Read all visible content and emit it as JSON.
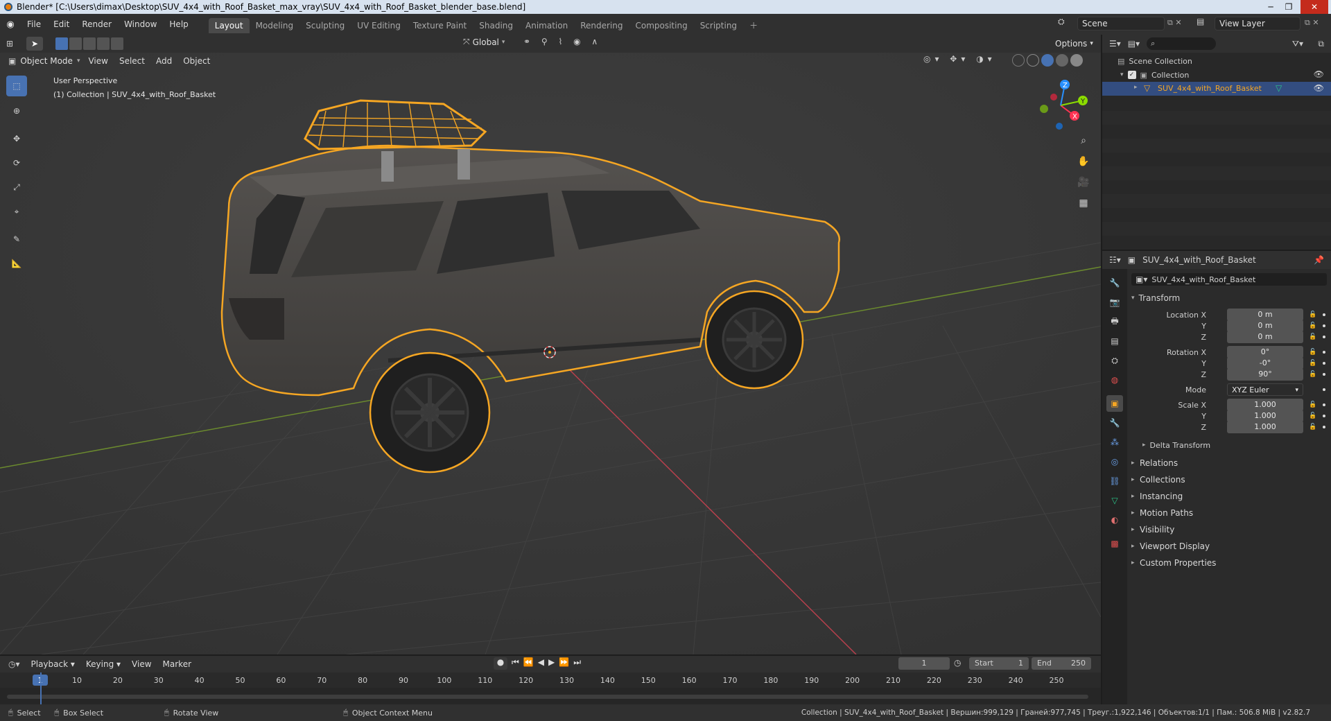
{
  "titlebar": {
    "title": "Blender* [C:\\Users\\dimax\\Desktop\\SUV_4x4_with_Roof_Basket_max_vray\\SUV_4x4_with_Roof_Basket_blender_base.blend]"
  },
  "menu": [
    "File",
    "Edit",
    "Render",
    "Window",
    "Help"
  ],
  "workspaces": [
    "Layout",
    "Modeling",
    "Sculpting",
    "UV Editing",
    "Texture Paint",
    "Shading",
    "Animation",
    "Rendering",
    "Compositing",
    "Scripting"
  ],
  "active_workspace": "Layout",
  "scene": "Scene",
  "view_layer": "View Layer",
  "toolbar_header": {
    "transform_orientation": "Global",
    "options": "Options"
  },
  "viewport_header": {
    "mode": "Object Mode",
    "menus": [
      "View",
      "Select",
      "Add",
      "Object"
    ]
  },
  "viewport": {
    "perspective": "User Perspective",
    "collection_info": "(1) Collection | SUV_4x4_with_Roof_Basket",
    "gizmo_axes": [
      "X",
      "Y",
      "Z"
    ]
  },
  "outliner": {
    "scene_collection": "Scene Collection",
    "collection": "Collection",
    "object": "SUV_4x4_with_Roof_Basket"
  },
  "properties": {
    "object_name": "SUV_4x4_with_Roof_Basket",
    "datablock": "SUV_4x4_with_Roof_Basket",
    "transform_title": "Transform",
    "location": {
      "label": "Location X",
      "x": "0 m",
      "y": "0 m",
      "z": "0 m"
    },
    "rotation": {
      "label": "Rotation X",
      "x": "0°",
      "y": "-0°",
      "z": "90°"
    },
    "mode_label": "Mode",
    "mode_value": "XYZ Euler",
    "scale": {
      "label": "Scale X",
      "x": "1.000",
      "y": "1.000",
      "z": "1.000"
    },
    "axis_y": "Y",
    "axis_z": "Z",
    "delta_transform": "Delta Transform",
    "panels": [
      "Relations",
      "Collections",
      "Instancing",
      "Motion Paths",
      "Visibility",
      "Viewport Display",
      "Custom Properties"
    ]
  },
  "timeline": {
    "menus": [
      "Playback",
      "Keying",
      "View",
      "Marker"
    ],
    "current_frame": "1",
    "start_label": "Start",
    "start": "1",
    "end_label": "End",
    "end": "250",
    "ruler": [
      "1",
      "10",
      "20",
      "30",
      "40",
      "50",
      "60",
      "70",
      "80",
      "90",
      "100",
      "110",
      "120",
      "130",
      "140",
      "150",
      "160",
      "170",
      "180",
      "190",
      "200",
      "210",
      "220",
      "230",
      "240",
      "250"
    ]
  },
  "statusbar": {
    "select": "Select",
    "box_select": "Box Select",
    "rotate_view": "Rotate View",
    "context_menu": "Object Context Menu",
    "stats": "Collection | SUV_4x4_with_Roof_Basket | Вершин:999,129 | Граней:977,745 | Треуг.:1,922,146 | Объектов:1/1 | Пам.: 506.8 MiB | v2.82.7"
  },
  "colors": {
    "accent": "#4772b3",
    "selection": "#f5a623",
    "x_axis": "#ff3352",
    "y_axis": "#8bdc00",
    "z_axis": "#2890ff"
  }
}
